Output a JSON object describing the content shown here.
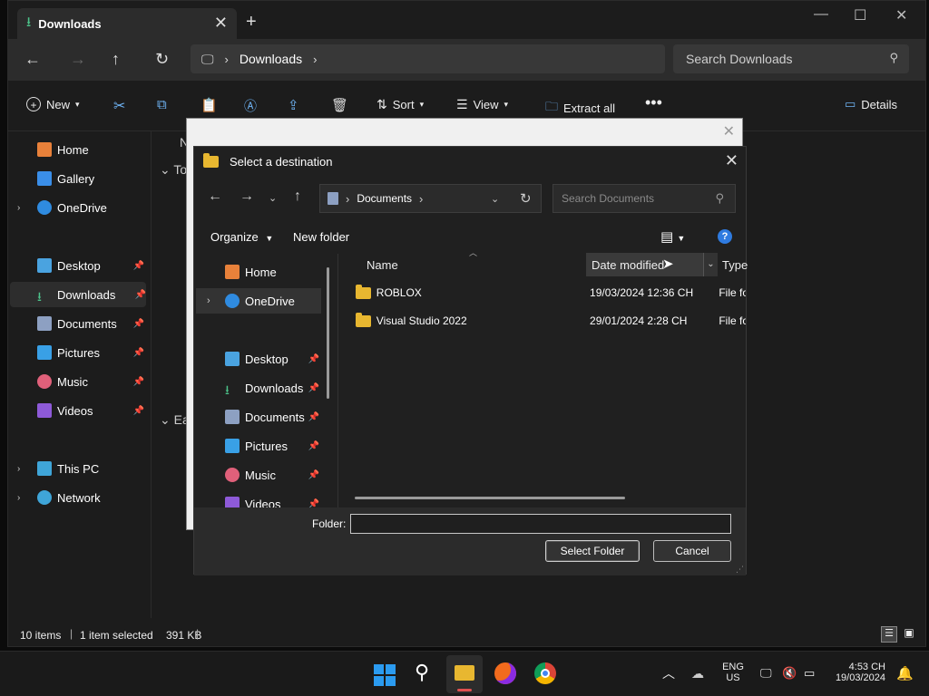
{
  "explorer": {
    "tab_title": "Downloads",
    "breadcrumb": "Downloads",
    "search_placeholder": "Search Downloads",
    "commands": {
      "new": "New",
      "sort": "Sort",
      "view": "View",
      "extract_all": "Extract all",
      "details": "Details"
    },
    "sidebar": [
      {
        "label": "Home"
      },
      {
        "label": "Gallery"
      },
      {
        "label": "OneDrive"
      },
      {
        "label": "Desktop"
      },
      {
        "label": "Downloads"
      },
      {
        "label": "Documents"
      },
      {
        "label": "Pictures"
      },
      {
        "label": "Music"
      },
      {
        "label": "Videos"
      },
      {
        "label": "This PC"
      },
      {
        "label": "Network"
      }
    ],
    "partial_text": {
      "n": "N",
      "today": "To",
      "earlier": "Ea"
    },
    "status": {
      "items": "10 items",
      "selected": "1 item selected",
      "size": "391 KB"
    }
  },
  "dialog": {
    "title": "Select a destination",
    "location": "Documents",
    "search_placeholder": "Search Documents",
    "organize": "Organize",
    "new_folder": "New folder",
    "help": "?",
    "sidebar": [
      {
        "label": "Home"
      },
      {
        "label": "OneDrive"
      },
      {
        "label": "Desktop"
      },
      {
        "label": "Downloads"
      },
      {
        "label": "Documents"
      },
      {
        "label": "Pictures"
      },
      {
        "label": "Music"
      },
      {
        "label": "Videos"
      }
    ],
    "columns": {
      "name": "Name",
      "date_modified": "Date modified",
      "type": "Type"
    },
    "rows": [
      {
        "name": "ROBLOX",
        "date": "19/03/2024 12:36 CH",
        "type": "File fo"
      },
      {
        "name": "Visual Studio 2022",
        "date": "29/01/2024 2:28 CH",
        "type": "File fo"
      }
    ],
    "folder_label": "Folder:",
    "folder_value": "",
    "select_button": "Select Folder",
    "cancel_button": "Cancel"
  },
  "taskbar": {
    "lang": "ENG",
    "region": "US",
    "time": "4:53 CH",
    "date": "19/03/2024"
  }
}
